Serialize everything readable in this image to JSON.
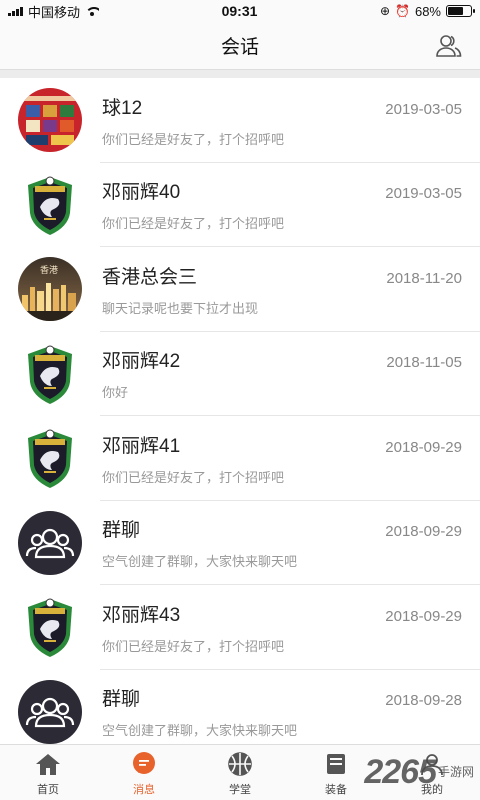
{
  "status_bar": {
    "carrier": "中国移动",
    "time": "09:31",
    "battery_pct": "68%",
    "battery_level": 0.68,
    "icons": [
      "signal-icon",
      "wifi-icon",
      "lock-rotation-icon",
      "alarm-icon",
      "battery-icon"
    ]
  },
  "header": {
    "title": "会话",
    "contacts_icon": "contacts-icon"
  },
  "conversations": [
    {
      "name": "球12",
      "preview": "你们已经是好友了，打个招呼吧",
      "date": "2019-03-05",
      "avatar": "red-collage"
    },
    {
      "name": "邓丽辉40",
      "preview": "你们已经是好友了，打个招呼吧",
      "date": "2019-03-05",
      "avatar": "dragon-badge"
    },
    {
      "name": "香港总会三",
      "preview": "聊天记录呢也要下拉才出现",
      "date": "2018-11-20",
      "avatar": "city-night"
    },
    {
      "name": "邓丽辉42",
      "preview": "你好",
      "date": "2018-11-05",
      "avatar": "dragon-badge"
    },
    {
      "name": "邓丽辉41",
      "preview": "你们已经是好友了，打个招呼吧",
      "date": "2018-09-29",
      "avatar": "dragon-badge"
    },
    {
      "name": "群聊",
      "preview": "空气创建了群聊，大家快来聊天吧",
      "date": "2018-09-29",
      "avatar": "group"
    },
    {
      "name": "邓丽辉43",
      "preview": "你们已经是好友了，打个招呼吧",
      "date": "2018-09-29",
      "avatar": "dragon-badge"
    },
    {
      "name": "群聊",
      "preview": "空气创建了群聊，大家快来聊天吧",
      "date": "2018-09-28",
      "avatar": "group"
    }
  ],
  "tabs": [
    {
      "label": "首页",
      "icon": "home-icon",
      "active": false
    },
    {
      "label": "消息",
      "icon": "message-icon",
      "active": true
    },
    {
      "label": "学堂",
      "icon": "basketball-icon",
      "active": false
    },
    {
      "label": "装备",
      "icon": "equipment-icon",
      "active": false
    },
    {
      "label": "我的",
      "icon": "profile-icon",
      "active": false
    }
  ],
  "watermark": {
    "number": "2265",
    "site": "手游网"
  },
  "colors": {
    "accent": "#e8622c",
    "avatar_dark": "#2c2a35"
  }
}
